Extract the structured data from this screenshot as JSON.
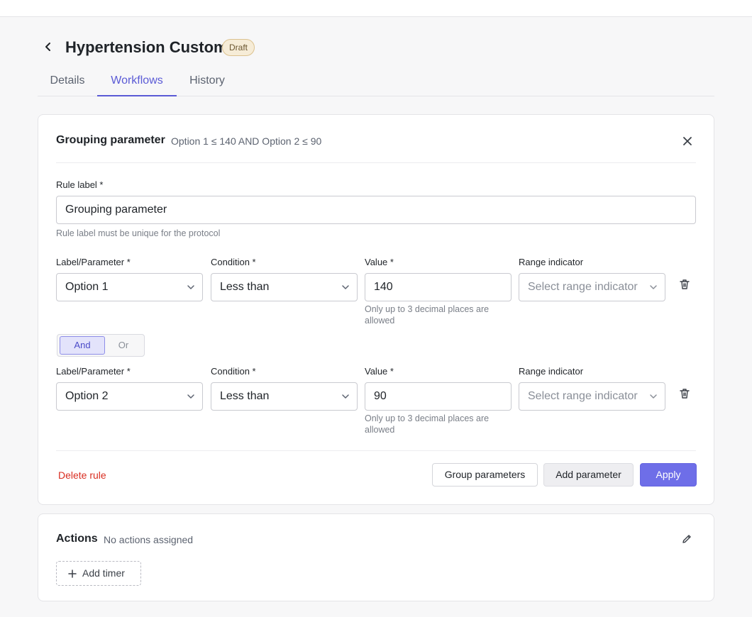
{
  "header": {
    "title": "Hypertension Custom",
    "status": "Draft"
  },
  "tabs": [
    {
      "label": "Details",
      "active": false
    },
    {
      "label": "Workflows",
      "active": true
    },
    {
      "label": "History",
      "active": false
    }
  ],
  "rule": {
    "title": "Grouping parameter",
    "summary": "Option 1 ≤ 140 AND Option 2 ≤ 90",
    "rule_label": {
      "label": "Rule label *",
      "value": "Grouping parameter",
      "helper": "Rule label must be unique for the protocol"
    },
    "conditions": [
      {
        "param_label": "Label/Parameter *",
        "param_value": "Option 1",
        "condition_label": "Condition *",
        "condition_value": "Less than",
        "value_label": "Value *",
        "value": "140",
        "value_helper_1": "Only up to 3 decimal places are",
        "value_helper_2": "allowed",
        "range_label": "Range indicator",
        "range_placeholder": "Select range indicator"
      },
      {
        "param_label": "Label/Parameter *",
        "param_value": "Option 2",
        "condition_label": "Condition *",
        "condition_value": "Less than",
        "value_label": "Value *",
        "value": "90",
        "value_helper_1": "Only up to 3 decimal places are",
        "value_helper_2": "allowed",
        "range_label": "Range indicator",
        "range_placeholder": "Select range indicator"
      }
    ],
    "operator": {
      "and_label": "And",
      "or_label": "Or",
      "selected": "And"
    },
    "footer": {
      "delete_label": "Delete rule",
      "group_label": "Group parameters",
      "add_param_label": "Add parameter",
      "apply_label": "Apply"
    }
  },
  "actions": {
    "title": "Actions",
    "summary": "No actions assigned",
    "add_timer_label": "Add timer"
  },
  "colors": {
    "accent": "#5b5bd6",
    "primary_button": "#6e6ee8",
    "danger": "#d92d20",
    "draft_badge_bg": "#f6ecd7"
  },
  "icons": [
    "chevron-left-icon",
    "close-icon",
    "chevron-down-icon",
    "trash-icon",
    "pencil-icon",
    "plus-icon"
  ]
}
